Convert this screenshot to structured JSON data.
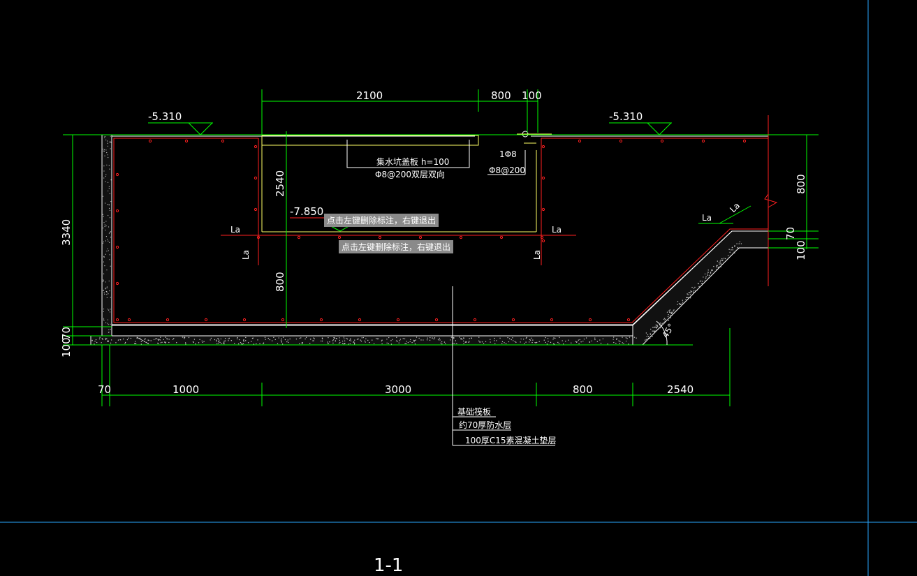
{
  "drawing": {
    "title": "1-1",
    "elevations": {
      "top_left": "-5.310",
      "top_right": "-5.310",
      "pit_bottom": "-7.850"
    },
    "dimensions": {
      "top": [
        "2100",
        "800",
        "100"
      ],
      "bottom": [
        "70",
        "1000",
        "3000",
        "800",
        "2540"
      ],
      "left": [
        "3340",
        "70",
        "100"
      ],
      "right": [
        "800",
        "70",
        "100"
      ],
      "pit_depth": "2540",
      "pit_lower": "800"
    },
    "labels": {
      "cover_slab": "集水坑盖板 h=100",
      "cover_rebar": "Φ8@200双层双向",
      "bar_1phi8": "1Φ8",
      "bar_phi8_200": "Φ8@200",
      "la_left": "La",
      "la_right": "La",
      "la_vertical_left": "La",
      "la_vertical_right": "La",
      "la_slope_1": "La",
      "la_slope_2": "La",
      "angle": "45°"
    },
    "legend": [
      "基础筏板",
      "约70厚防水层",
      "100厚C15素混凝土垫层"
    ],
    "tooltips": [
      "点击左键删除标注，右键退出",
      "点击左键删除标注，右键退出"
    ]
  },
  "colors": {
    "dim_line": "#00ff00",
    "rebar": "#ff2020",
    "outline": "#ffffff",
    "frame": "#2aa8ff",
    "slab": "#ffff66"
  }
}
